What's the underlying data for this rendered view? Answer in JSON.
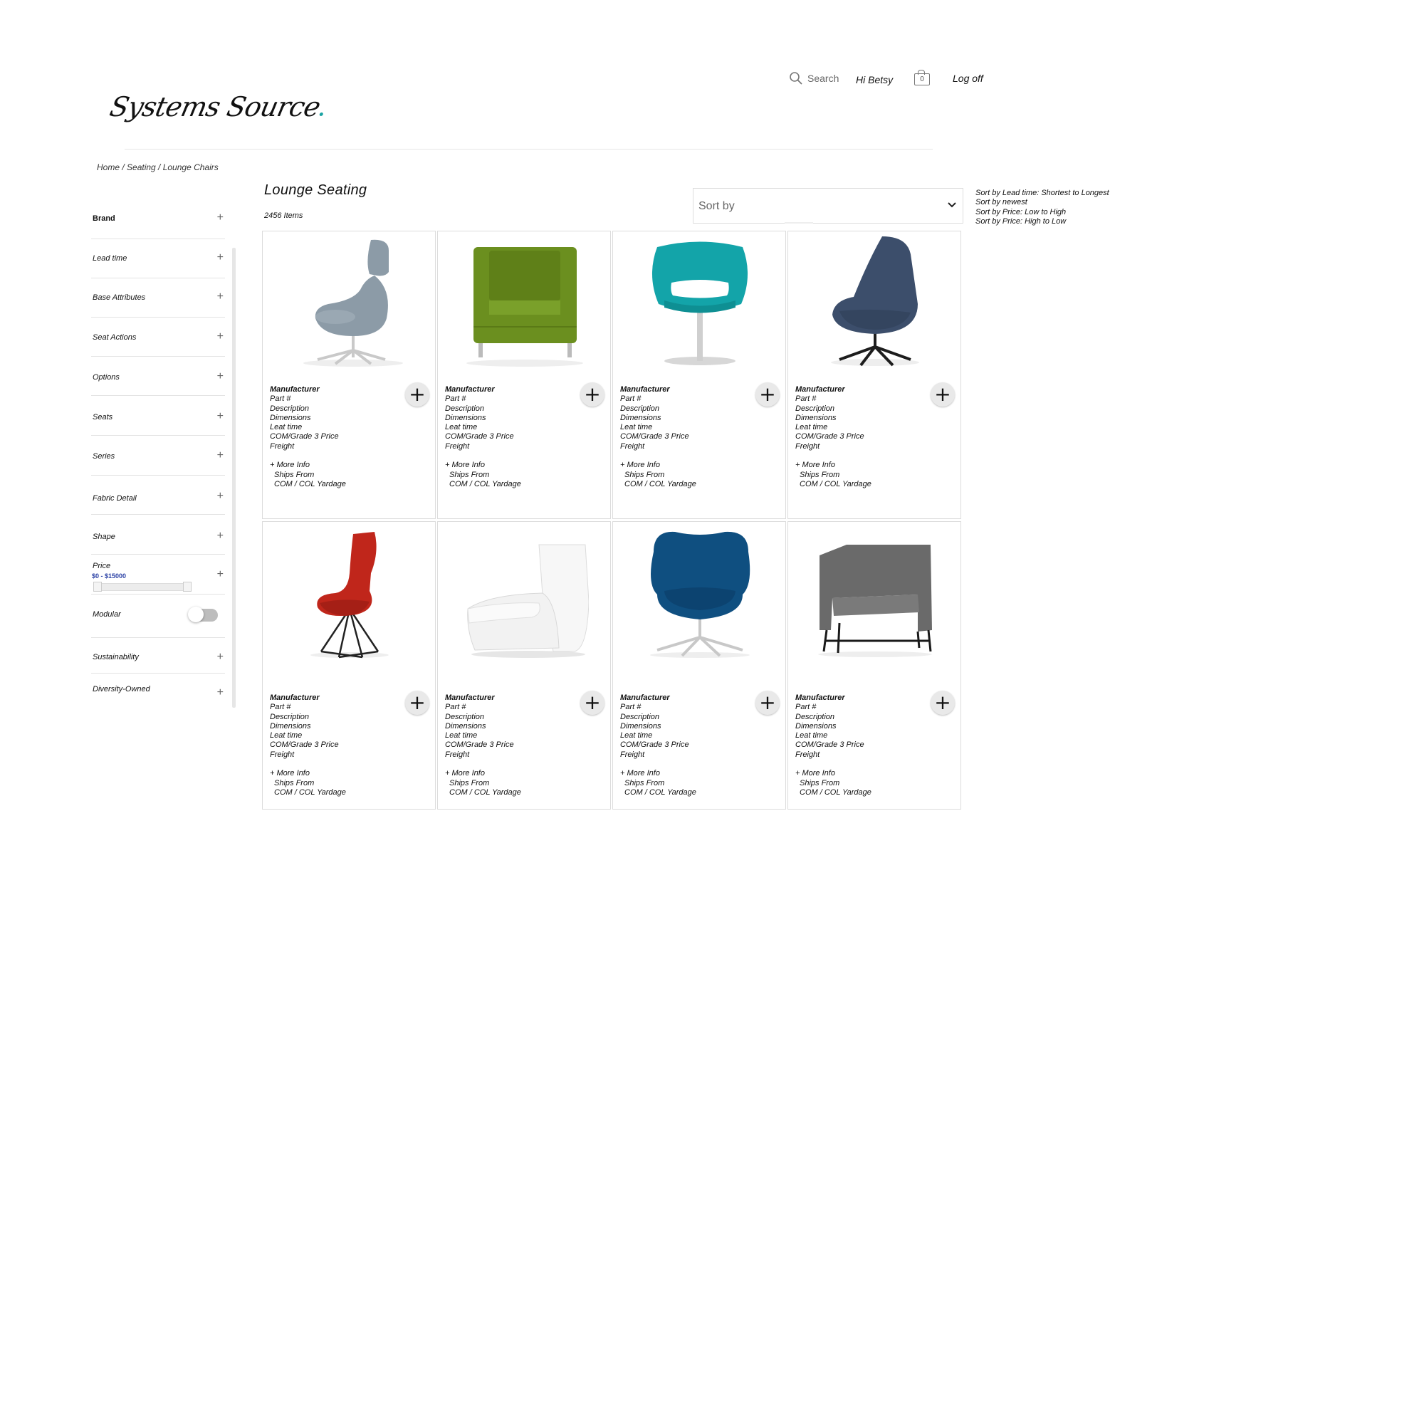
{
  "header": {
    "logo_text": "Systems Source",
    "search_label": "Search",
    "greeting": "Hi Betsy",
    "cart_count": "0",
    "logoff_label": "Log off"
  },
  "breadcrumb": "Home / Seating / Lounge Chairs",
  "sidebar": {
    "filters": [
      {
        "label": "Brand"
      },
      {
        "label": "Lead time"
      },
      {
        "label": "Base Attributes"
      },
      {
        "label": "Seat Actions"
      },
      {
        "label": "Options"
      },
      {
        "label": "Seats"
      },
      {
        "label": "Series"
      },
      {
        "label": "Fabric Detail"
      },
      {
        "label": "Shape"
      },
      {
        "label": "Price",
        "range": "$0 - $15000",
        "min": 0,
        "max": 15000
      },
      {
        "label": "Modular",
        "toggle_on": false
      },
      {
        "label": "Sustainability"
      },
      {
        "label": "Diversity-Owned"
      }
    ]
  },
  "main": {
    "title": "Lounge Seating",
    "item_count": "2456 Items",
    "sort": {
      "label": "Sort by",
      "options": [
        "Sort by Lead time: Shortest to Longest",
        "Sort by newest",
        "Sort by Price: Low to High",
        "Sort by Price: High to Low"
      ]
    },
    "card_fields": {
      "manufacturer": "Manufacturer",
      "part": "Part #",
      "description": "Description",
      "dimensions": "Dimensions",
      "lead_time": "Leat time",
      "price": "COM/Grade 3 Price",
      "freight": "Freight",
      "more_info": "+ More Info",
      "ships_from": "Ships From",
      "yardage": "COM / COL Yardage"
    },
    "products": [
      {
        "image": "gray-highback-lounge-chair",
        "color": "#8c9ba7"
      },
      {
        "image": "green-club-chair",
        "color": "#6b8f1f"
      },
      {
        "image": "teal-swivel-chair",
        "color": "#13a4a9"
      },
      {
        "image": "navy-shell-chair",
        "color": "#3c4e6b"
      },
      {
        "image": "red-wingback-chair",
        "color": "#c0261b"
      },
      {
        "image": "white-lounge-chair",
        "color": "#f2f2f2"
      },
      {
        "image": "blue-swivel-lounge-chair",
        "color": "#0f4f80"
      },
      {
        "image": "gray-armchair",
        "color": "#6a6a6a"
      }
    ]
  }
}
